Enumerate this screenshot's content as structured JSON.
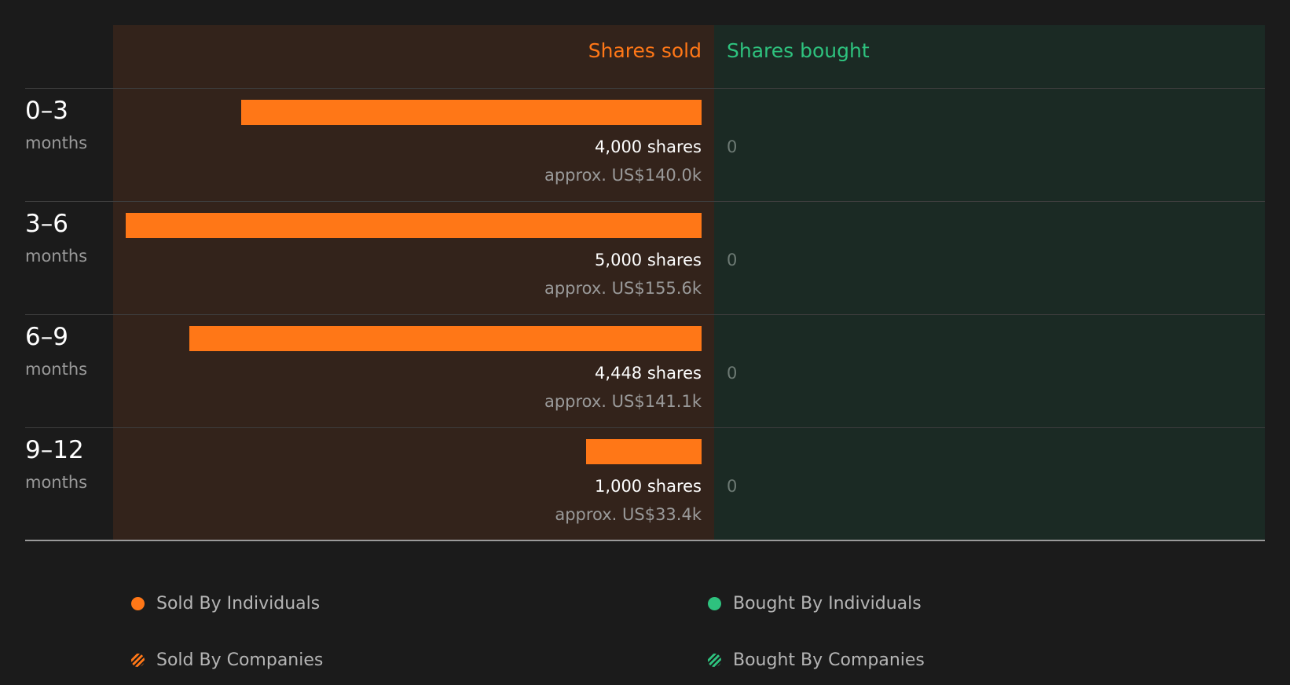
{
  "chart_data": {
    "type": "bar",
    "orientation": "horizontal-diverging",
    "columns": {
      "sold": "Shares sold",
      "bought": "Shares bought"
    },
    "categories": [
      {
        "range": "0–3",
        "unit": "months"
      },
      {
        "range": "3–6",
        "unit": "months"
      },
      {
        "range": "6–9",
        "unit": "months"
      },
      {
        "range": "9–12",
        "unit": "months"
      }
    ],
    "series": [
      {
        "name": "Sold By Individuals",
        "values": [
          4000,
          5000,
          4448,
          1000
        ],
        "labels": [
          "4,000 shares",
          "5,000 shares",
          "4,448 shares",
          "1,000 shares"
        ],
        "approx": [
          "approx. US$140.0k",
          "approx. US$155.6k",
          "approx. US$141.1k",
          "approx. US$33.4k"
        ]
      },
      {
        "name": "Bought By Individuals",
        "values": [
          0,
          0,
          0,
          0
        ],
        "labels": [
          "0",
          "0",
          "0",
          "0"
        ]
      }
    ],
    "xlim": [
      0,
      5000
    ],
    "legend": [
      {
        "name": "Sold By Individuals",
        "style": "solid",
        "color": "#ff7717"
      },
      {
        "name": "Bought By Individuals",
        "style": "solid",
        "color": "#2ec27e"
      },
      {
        "name": "Sold By Companies",
        "style": "hatched",
        "color": "#ff7717"
      },
      {
        "name": "Bought By Companies",
        "style": "hatched",
        "color": "#2ec27e"
      }
    ],
    "legend_placement": "bottom"
  },
  "colors": {
    "sold": "#ff7717",
    "bought": "#2ec27e",
    "background": "#1b1b1b",
    "sold_panel": "#33231b",
    "bought_panel": "#1b2a24"
  }
}
